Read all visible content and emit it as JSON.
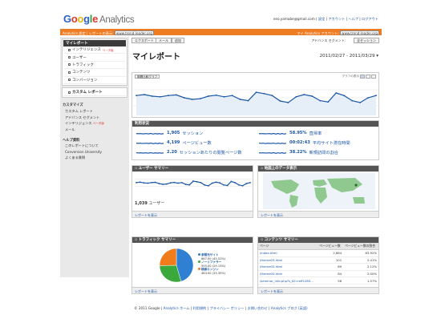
{
  "brand": {
    "g": "Google",
    "analytics": "Analytics"
  },
  "header": {
    "email": "neo.yamabe@gmail.com",
    "links": [
      "設定",
      "アカウント",
      "ヘルプ",
      "ログアウト"
    ]
  },
  "orangebar": {
    "settings": "Analytics 設定",
    "report_label": "レポートの表示:",
    "site_select": "www.trend-leader.org",
    "my_account_label": "マイ Analytics アカウント:",
    "account_select": "www.trend-leader.org"
  },
  "sidebar": {
    "dashboard": "マイレポート",
    "nav": [
      "インテリジェンス",
      "ユーザー",
      "トラフィック",
      "コンテンツ",
      "コンバージョン"
    ],
    "intelligence_badge": "ベータ版",
    "custom_reports": "カスタム レポート",
    "customize_title": "カスタマイズ",
    "customize_links": [
      "カスタム レポート",
      "アドバンス セグメント",
      "インテリジェンス",
      "メール"
    ],
    "customize_badge": "ベータ版",
    "help_title": "ヘルプ資料",
    "help_links": [
      "このレポートについて",
      "Conversion University",
      "よくある質問"
    ]
  },
  "toolbar": {
    "export": "エクスポート",
    "email": "メール",
    "add": "追加",
    "segment": "アドバンス セグメント:",
    "segment_value": "全セッション"
  },
  "report": {
    "title": "マイレポート",
    "date_range": "2011/02/27 - 2011/03/29"
  },
  "graph": {
    "selector": "期間比較グラフ",
    "label": "グラフの表示"
  },
  "chart_data": {
    "type": "line",
    "title": "",
    "x": [
      "2011/02/27",
      "2011/02/28",
      "2011/03/01",
      "2011/03/02",
      "2011/03/03",
      "2011/03/04",
      "2011/03/05",
      "2011/03/06",
      "2011/03/07",
      "2011/03/08",
      "2011/03/09",
      "2011/03/10",
      "2011/03/11",
      "2011/03/12",
      "2011/03/13",
      "2011/03/14",
      "2011/03/15",
      "2011/03/16",
      "2011/03/17",
      "2011/03/18",
      "2011/03/19",
      "2011/03/20",
      "2011/03/21",
      "2011/03/22",
      "2011/03/23",
      "2011/03/24",
      "2011/03/25",
      "2011/03/26",
      "2011/03/27",
      "2011/03/28",
      "2011/03/29"
    ],
    "series": [
      {
        "name": "",
        "values": [
          62,
          65,
          60,
          58,
          62,
          64,
          55,
          50,
          52,
          60,
          63,
          58,
          62,
          50,
          46,
          72,
          68,
          62,
          45,
          40,
          58,
          65,
          60,
          46,
          42,
          70,
          62,
          46,
          40,
          55,
          62
        ]
      }
    ],
    "xlabels": [
      "",
      "",
      ""
    ],
    "ylim": [
      0,
      100
    ],
    "grid": true,
    "color": "#1d57a6"
  },
  "overview": {
    "title": "利用状況",
    "metrics": [
      {
        "value": "1,905",
        "label": "セッション"
      },
      {
        "value": "4,199",
        "label": "ページビュー数"
      },
      {
        "value": "2.20",
        "label": "セッションあたりの閲覧ページ数"
      },
      {
        "value": "58.95%",
        "label": "直帰率"
      },
      {
        "value": "00:02:43",
        "label": "平均サイト滞在時間"
      },
      {
        "value": "38.22%",
        "label": "新規訪問の割合"
      }
    ]
  },
  "users_panel": {
    "title": "ユーザー サマリー",
    "count": "1,039",
    "unit": "ユーザー",
    "footer": "レポートを表示"
  },
  "map_panel": {
    "title": "地図上のデータ表示",
    "footer": "レポートを表示"
  },
  "traffic_panel": {
    "title": "トラフィック サマリー",
    "footer": "レポートを表示",
    "slices": [
      {
        "label": "参照元サイト",
        "detail": "867.00 (45.51%)",
        "value": 45.51,
        "color": "#2f7fd2"
      },
      {
        "label": "ノーリファラー",
        "detail": "555.00 (29.13%)",
        "value": 29.13,
        "color": "#3aa83a"
      },
      {
        "label": "検索エンジン",
        "detail": "483.00 (25.35%)",
        "value": 25.35,
        "color": "#f07c1c"
      }
    ]
  },
  "content_panel": {
    "title": "コンテンツ サマリー",
    "footer": "レポートを表示",
    "headers": [
      "ページ",
      "ページビュー数",
      "ページビュー数の割合"
    ],
    "rows": [
      [
        "/index.html",
        "2,684",
        "63.92%"
      ],
      [
        "/theme03.html",
        "101",
        "2.41%"
      ],
      [
        "/theme02.html",
        "89",
        "2.12%"
      ],
      [
        "/theme00.html",
        "84",
        "2.00%"
      ],
      [
        "/seminar_info.php?s_ID=reff1285...",
        "56",
        "1.57%"
      ]
    ]
  },
  "footer": {
    "copyright": "© 2011 Google",
    "links": [
      "Analytics ホーム",
      "利用規約",
      "プライバシー ポリシー",
      "お問い合わせ",
      "Analytics ブログ (英語)"
    ]
  }
}
